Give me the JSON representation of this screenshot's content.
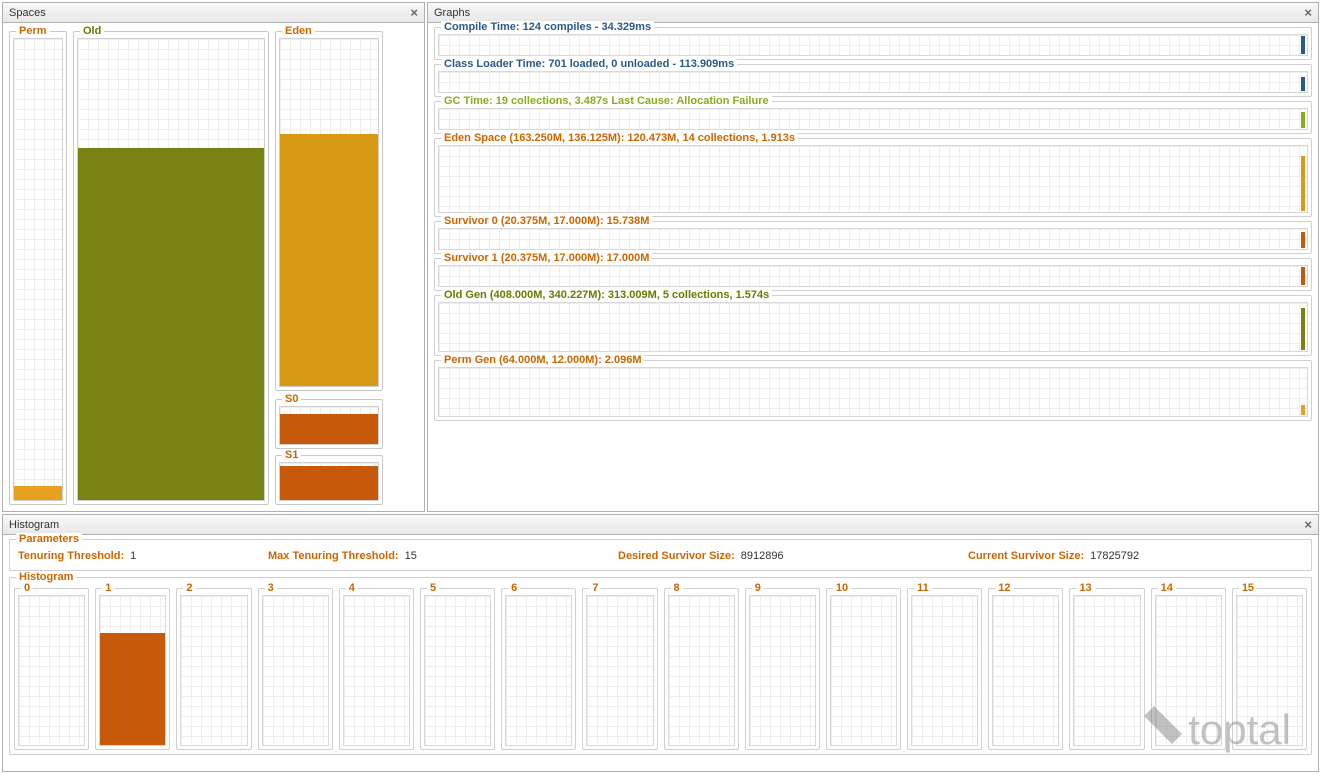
{
  "panels": {
    "spaces": {
      "title": "Spaces"
    },
    "graphs": {
      "title": "Graphs"
    },
    "histogram": {
      "title": "Histogram"
    }
  },
  "spaces": {
    "perm": {
      "label": "Perm",
      "color": "#cc6600",
      "fill_pct": 3,
      "fill_color": "#e8a020"
    },
    "old": {
      "label": "Old",
      "color": "#6b7a00",
      "fill_pct": 75,
      "fill_color": "#7a8213"
    },
    "eden": {
      "label": "Eden",
      "color": "#cc6600",
      "fill_pct": 72,
      "fill_color": "#d99a16"
    },
    "s0": {
      "label": "S0",
      "color": "#cc6600",
      "fill_pct": 75,
      "fill_color": "#c65a0a"
    },
    "s1": {
      "label": "S1",
      "color": "#cc6600",
      "fill_pct": 82,
      "fill_color": "#c65a0a"
    }
  },
  "graphs": [
    {
      "id": "compile",
      "label": "Compile Time: 124 compiles - 34.329ms",
      "color": "#2a5a8a",
      "height": "small",
      "spike_color": "#2a5a8a",
      "spike_h": 18
    },
    {
      "id": "classload",
      "label": "Class Loader Time: 701 loaded, 0 unloaded - 113.909ms",
      "color": "#2a5a8a",
      "height": "small",
      "spike_color": "#2a5a8a",
      "spike_h": 14
    },
    {
      "id": "gc",
      "label": "GC Time: 19 collections, 3.487s  Last Cause: Allocation Failure",
      "color": "#8aad1e",
      "height": "small",
      "spike_color": "#8aad1e",
      "spike_h": 16
    },
    {
      "id": "eden",
      "label": "Eden Space (163.250M, 136.125M): 120.473M, 14 collections, 1.913s",
      "color": "#cc6600",
      "height": "tall",
      "spike_color": "#d99a16",
      "spike_h": 55
    },
    {
      "id": "surv0",
      "label": "Survivor 0 (20.375M, 17.000M): 15.738M",
      "color": "#cc6600",
      "height": "small",
      "spike_color": "#c65a0a",
      "spike_h": 16
    },
    {
      "id": "surv1",
      "label": "Survivor 1 (20.375M, 17.000M): 17.000M",
      "color": "#cc6600",
      "height": "small",
      "spike_color": "#c65a0a",
      "spike_h": 18
    },
    {
      "id": "oldgen",
      "label": "Old Gen (408.000M, 340.227M): 313.009M, 5 collections, 1.574s",
      "color": "#6b7a00",
      "height": "mid",
      "spike_color": "#7a8213",
      "spike_h": 42
    },
    {
      "id": "permgen",
      "label": "Perm Gen (64.000M, 12.000M): 2.096M",
      "color": "#cc6600",
      "height": "mid",
      "spike_color": "#e8a020",
      "spike_h": 10
    }
  ],
  "parameters": {
    "box_label": "Parameters",
    "tenuring_threshold": {
      "label": "Tenuring Threshold:",
      "value": "1"
    },
    "max_tenuring_threshold": {
      "label": "Max Tenuring Threshold:",
      "value": "15"
    },
    "desired_survivor_size": {
      "label": "Desired Survivor Size:",
      "value": "8912896"
    },
    "current_survivor_size": {
      "label": "Current Survivor Size:",
      "value": "17825792"
    }
  },
  "histogram": {
    "box_label": "Histogram",
    "bins": [
      {
        "n": "0",
        "fill_pct": 0
      },
      {
        "n": "1",
        "fill_pct": 75
      },
      {
        "n": "2",
        "fill_pct": 0
      },
      {
        "n": "3",
        "fill_pct": 0
      },
      {
        "n": "4",
        "fill_pct": 0
      },
      {
        "n": "5",
        "fill_pct": 0
      },
      {
        "n": "6",
        "fill_pct": 0
      },
      {
        "n": "7",
        "fill_pct": 0
      },
      {
        "n": "8",
        "fill_pct": 0
      },
      {
        "n": "9",
        "fill_pct": 0
      },
      {
        "n": "10",
        "fill_pct": 0
      },
      {
        "n": "11",
        "fill_pct": 0
      },
      {
        "n": "12",
        "fill_pct": 0
      },
      {
        "n": "13",
        "fill_pct": 0
      },
      {
        "n": "14",
        "fill_pct": 0
      },
      {
        "n": "15",
        "fill_pct": 0
      }
    ]
  },
  "watermark": "toptal",
  "chart_data": {
    "spaces": [
      {
        "name": "Perm",
        "fill_pct": 3
      },
      {
        "name": "Old",
        "fill_pct": 75
      },
      {
        "name": "Eden",
        "fill_pct": 72
      },
      {
        "name": "S0",
        "fill_pct": 75
      },
      {
        "name": "S1",
        "fill_pct": 82
      }
    ],
    "histogram": {
      "type": "bar",
      "categories": [
        "0",
        "1",
        "2",
        "3",
        "4",
        "5",
        "6",
        "7",
        "8",
        "9",
        "10",
        "11",
        "12",
        "13",
        "14",
        "15"
      ],
      "values": [
        0,
        75,
        0,
        0,
        0,
        0,
        0,
        0,
        0,
        0,
        0,
        0,
        0,
        0,
        0,
        0
      ],
      "title": "Tenuring Histogram (%)"
    }
  }
}
